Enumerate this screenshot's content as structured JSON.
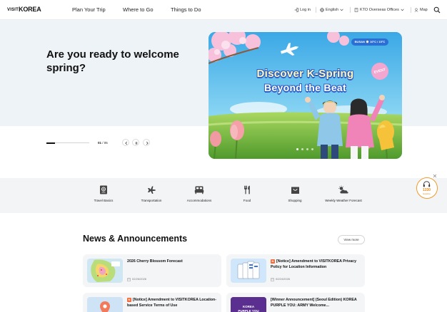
{
  "header": {
    "logo_main": "VISITKOREA",
    "logo_prefix": "VISIT",
    "logo_suffix": "KOREA",
    "nav": [
      "Plan Your Trip",
      "Where to Go",
      "Things to Do"
    ],
    "login": "Log in",
    "language": "English",
    "offices": "KTO Overseas Offices",
    "map": "Map",
    "icons": [
      "login-icon",
      "globe-icon",
      "building-icon",
      "map-pin-icon",
      "search-icon"
    ]
  },
  "hero": {
    "title": "Are you ready to welcome spring?",
    "slide_current": "01",
    "slide_total": "05",
    "slide_separator": " / ",
    "progress": 0.2,
    "controls": [
      "prev-arrow-icon",
      "pause-icon",
      "next-arrow-icon"
    ]
  },
  "banner": {
    "line1": "Discover K-Spring",
    "line2": "Beyond the Beat",
    "tag": "BUSAN  ⌚ 10°C / 15°C",
    "badge": "EVENT",
    "dot_count": 4,
    "active_dot": 0
  },
  "categories": [
    {
      "label": "Travel Basics",
      "icon": "passport-icon"
    },
    {
      "label": "Transportation",
      "icon": "airplane-icon"
    },
    {
      "label": "Accommodations",
      "icon": "bed-icon"
    },
    {
      "label": "Food",
      "icon": "fork-knife-icon"
    },
    {
      "label": "Shopping",
      "icon": "shopping-bag-icon"
    },
    {
      "label": "Weekly Weather Forecast",
      "icon": "weather-icon"
    }
  ],
  "helpline": {
    "number": "1330",
    "text": "Helpline"
  },
  "news": {
    "title": "News & Announcements",
    "view_more": "View more",
    "items": [
      {
        "title": "2026 Cherry Blossom Forecast",
        "date": "02/26/2026",
        "notice": false
      },
      {
        "title": "[Notice] Amendment to VISITKOREA Privacy Policy for Location Information",
        "date": "02/24/2026",
        "notice": true
      },
      {
        "title": "[Notice] Amendment to VISITKOREA Location-based Service Terms of Use",
        "date": "",
        "notice": true
      },
      {
        "title": "[Winner Announcement] (Seoul Edition) KOREA PURPLE YOU: ARMY Welcome...",
        "date": "",
        "notice": true
      }
    ]
  },
  "colors": {
    "hero_bg": "#eef3f7",
    "category_bg": "#f3f4f6",
    "card_bg": "#f4f5f7",
    "accent_orange": "#f08c1a",
    "notice_badge": "#f06a3a",
    "banner_sky": "#4cb7e6"
  }
}
